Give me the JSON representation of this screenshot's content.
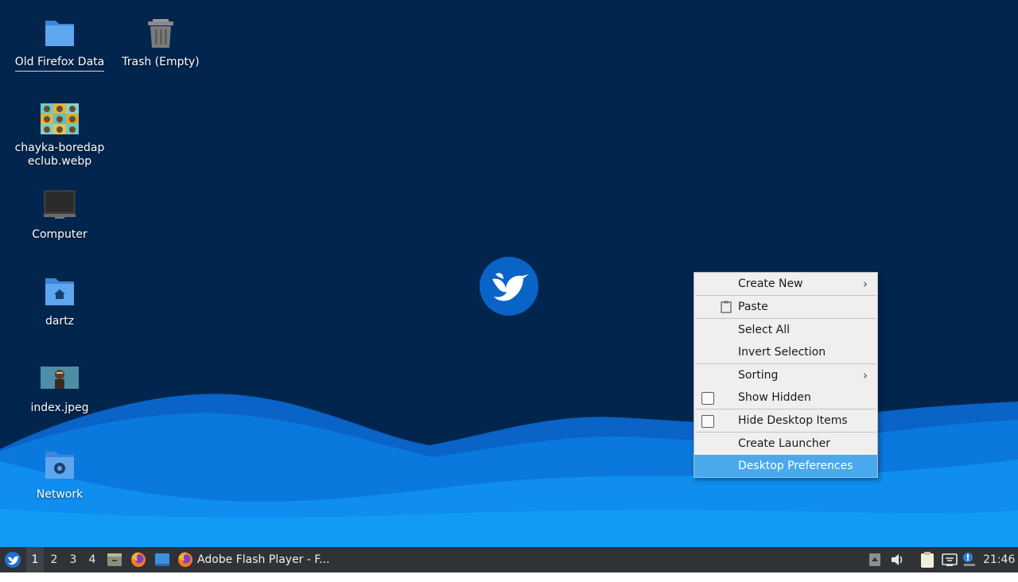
{
  "desktop": {
    "icons": [
      {
        "label": "Old Firefox Data",
        "icon": "folder-icon"
      },
      {
        "label": "Trash (Empty)",
        "icon": "trash-icon"
      },
      {
        "label": "chayka-boredapeclub.webp",
        "icon": "image-thumbnail-icon"
      },
      {
        "label": "Computer",
        "icon": "computer-icon"
      },
      {
        "label": "dartz",
        "icon": "home-folder-icon"
      },
      {
        "label": "index.jpeg",
        "icon": "image-thumbnail-icon"
      },
      {
        "label": "Network",
        "icon": "network-folder-icon"
      }
    ]
  },
  "context_menu": {
    "items": [
      {
        "label": "Create New",
        "submenu": true
      },
      {
        "label": "Paste",
        "icon": "paste-icon"
      },
      {
        "label": "Select All"
      },
      {
        "label": "Invert Selection"
      },
      {
        "label": "Sorting",
        "submenu": true
      },
      {
        "label": "Show Hidden",
        "checkbox": false
      },
      {
        "label": "Hide Desktop Items",
        "checkbox": false
      },
      {
        "label": "Create Launcher"
      },
      {
        "label": "Desktop Preferences",
        "highlighted": true
      }
    ]
  },
  "taskbar": {
    "workspaces": [
      "1",
      "2",
      "3",
      "4"
    ],
    "active_workspace": "1",
    "launchers": [
      "file-manager-icon",
      "firefox-icon",
      "desktop-icon"
    ],
    "task_label": "Adobe Flash Player - F...",
    "tray": [
      "tray-arrow-icon",
      "volume-icon",
      "clipboard-icon",
      "network-icon",
      "update-notifier-icon"
    ],
    "clock": "21:46"
  },
  "colors": {
    "desktop_bg": "#02254e",
    "wave_light": "#0e8ff0",
    "wave_mid": "#0a6fd0",
    "menu_highlight": "#4aa8ec",
    "taskbar_bg": "#2f3236"
  }
}
